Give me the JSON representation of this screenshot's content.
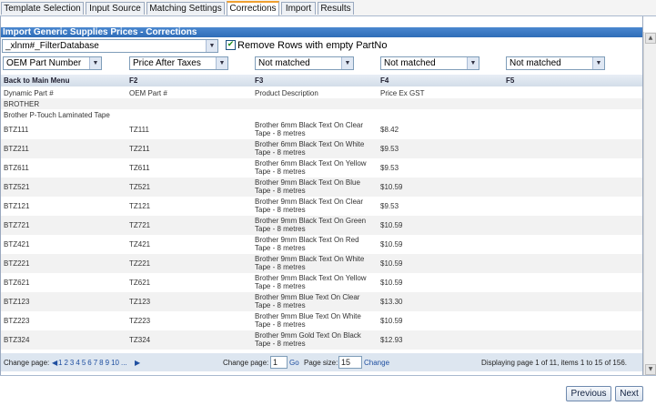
{
  "tabs": [
    "Template Selection",
    "Input Source",
    "Matching Settings",
    "Corrections",
    "Import",
    "Results"
  ],
  "title": "Import Generic Supplies Prices - Corrections",
  "filter_select": "_xlnm#_FilterDatabase",
  "remove_rows_label": "Remove Rows with empty PartNo",
  "remove_rows_checked": "✔",
  "mapping_selects": [
    "OEM Part Number",
    "Price After Taxes",
    "Not matched",
    "Not matched",
    "Not matched"
  ],
  "grid_headers": [
    "Back to Main Menu",
    "F2",
    "F3",
    "F4",
    "F5"
  ],
  "field_names": [
    "Dynamic Part #",
    "OEM Part #",
    "Product Description",
    "Price Ex GST"
  ],
  "group_rows": [
    "BROTHER",
    "Brother P-Touch Laminated Tape"
  ],
  "rows": [
    {
      "part": "BTZ111",
      "oem": "TZ111",
      "desc1": "Brother 6mm Black Text On Clear",
      "desc2": "Tape - 8 metres",
      "price": "$8.42"
    },
    {
      "part": "BTZ211",
      "oem": "TZ211",
      "desc1": "Brother 6mm Black Text On White",
      "desc2": "Tape - 8 metres",
      "price": "$9.53"
    },
    {
      "part": "BTZ611",
      "oem": "TZ611",
      "desc1": "Brother 6mm Black Text On Yellow",
      "desc2": "Tape - 8 metres",
      "price": "$9.53"
    },
    {
      "part": "BTZ521",
      "oem": "TZ521",
      "desc1": "Brother 9mm Black Text On Blue",
      "desc2": "Tape - 8 metres",
      "price": "$10.59"
    },
    {
      "part": "BTZ121",
      "oem": "TZ121",
      "desc1": "Brother 9mm Black Text On Clear",
      "desc2": "Tape - 8 metres",
      "price": "$9.53"
    },
    {
      "part": "BTZ721",
      "oem": "TZ721",
      "desc1": "Brother 9mm Black Text On Green",
      "desc2": "Tape - 8 metres",
      "price": "$10.59"
    },
    {
      "part": "BTZ421",
      "oem": "TZ421",
      "desc1": "Brother 9mm Black Text On Red",
      "desc2": "Tape - 8 metres",
      "price": "$10.59"
    },
    {
      "part": "BTZ221",
      "oem": "TZ221",
      "desc1": "Brother 9mm Black Text On White",
      "desc2": "Tape - 8 metres",
      "price": "$10.59"
    },
    {
      "part": "BTZ621",
      "oem": "TZ621",
      "desc1": "Brother 9mm Black Text On Yellow",
      "desc2": "Tape - 8 metres",
      "price": "$10.59"
    },
    {
      "part": "BTZ123",
      "oem": "TZ123",
      "desc1": "Brother 9mm Blue Text On Clear",
      "desc2": "Tape - 8 metres",
      "price": "$13.30"
    },
    {
      "part": "BTZ223",
      "oem": "TZ223",
      "desc1": "Brother 9mm Blue Text On White",
      "desc2": "Tape - 8 metres",
      "price": "$10.59"
    },
    {
      "part": "BTZ324",
      "oem": "TZ324",
      "desc1": "Brother 9mm Gold Text On Black",
      "desc2": "Tape - 8 metres",
      "price": "$12.93"
    }
  ],
  "pager": {
    "change_page_label": "Change page:",
    "prev_arrow": "◀",
    "pages": [
      "1",
      "2",
      "3",
      "4",
      "5",
      "6",
      "7",
      "8",
      "9",
      "10",
      "..."
    ],
    "next_arrow": "▶",
    "change_page_label2": "Change page:",
    "page_value": "1",
    "go": "Go",
    "page_size_label": "Page size:",
    "page_size_value": "15",
    "change": "Change",
    "status": "Displaying page 1 of 11, items 1 to 15 of 156."
  },
  "buttons": {
    "previous": "Previous",
    "next": "Next"
  },
  "icons": {
    "dropdown": "chevron-down-icon",
    "check": "check-icon"
  }
}
